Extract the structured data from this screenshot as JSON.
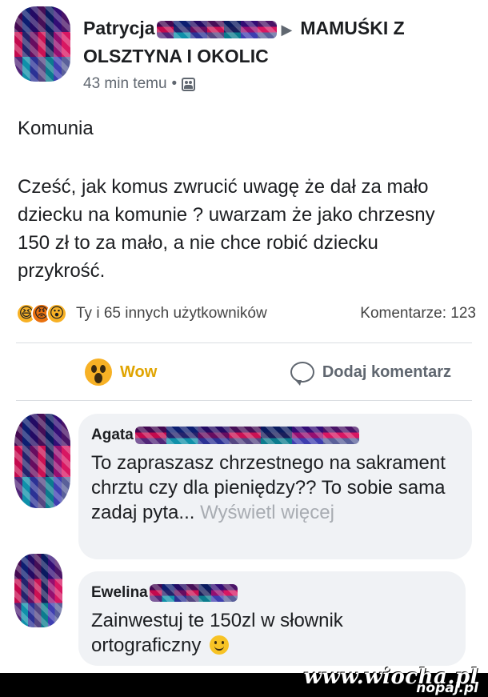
{
  "post": {
    "author_visible": "Patrycja",
    "group_name_part1": "MAMUŚKI Z",
    "group_name_part2": "OLSZTYNA I OKOLIC",
    "time": "43 min temu",
    "separator": "•",
    "title": "Komunia",
    "body": "Cześć, jak komus zwrucić uwagę że dał za mało dziecku na komunie ? uwarzam że jako chrzesny 150 zł to za mało, a nie chce robić dziecku przykrość."
  },
  "reactions": {
    "icons": [
      "haha-icon",
      "angry-icon",
      "wow-icon"
    ],
    "summary": "Ty i 65 innych użytkowników",
    "comments_count": "Komentarze: 123"
  },
  "actions": {
    "reaction_label": "Wow",
    "comment_label": "Dodaj komentarz"
  },
  "comments": [
    {
      "author_visible": "Agata",
      "text": "To zapraszasz chrzestnego na sakrament chrztu czy dla pieniędzy?? To sobie sama zadaj pyta...",
      "see_more": "Wyświetl więcej"
    },
    {
      "author_visible": "Ewelina",
      "text": "Zainwestuj te 150zl w słownik ortograficzny"
    }
  ],
  "watermark": {
    "main": "www.wiocha.pl",
    "sub": "nopaj.pl"
  },
  "colors": {
    "accent_wow": "#e0a400",
    "reaction_yellow": "#f7b125",
    "bubble_bg": "#f0f2f5",
    "meta_gray": "#606770"
  }
}
